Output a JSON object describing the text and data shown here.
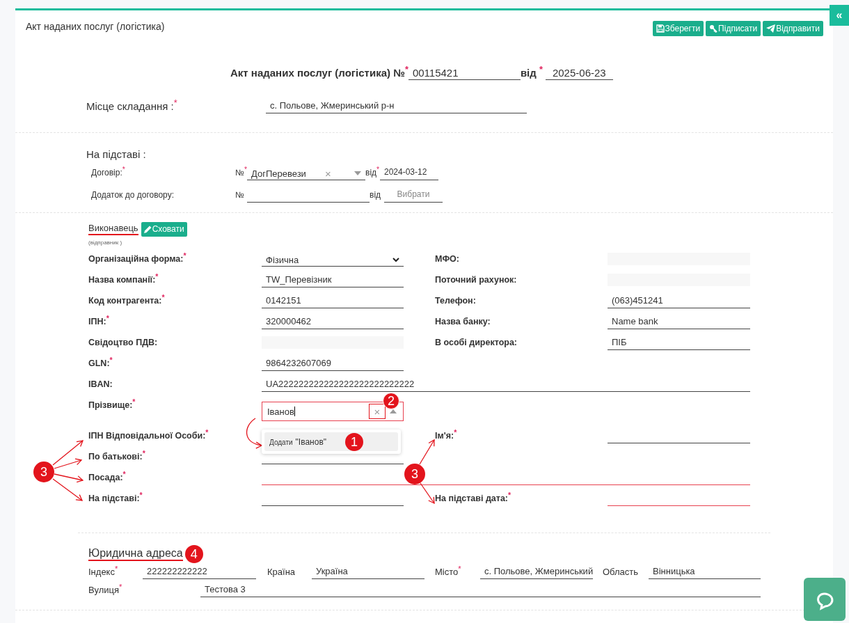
{
  "collapse_button": {
    "label": "«"
  },
  "header": {
    "title": "Акт наданих послуг (логістика)",
    "buttons": [
      {
        "label": "Зберегти",
        "kind": "save"
      },
      {
        "label": "Підписати",
        "kind": "sign"
      },
      {
        "label": "Відправити",
        "kind": "send"
      }
    ]
  },
  "document": {
    "label": "Акт наданих послуг (логістика) №$^{*}$",
    "number": "00115421",
    "date_label": "від $^{*}$",
    "date": "2025-06-23"
  },
  "place": {
    "label": "Місце складання :$^{*}$",
    "value": "с. Польове, Жмеринський р-н"
  },
  "basis": {
    "title": "На підставі :",
    "rows": [
      {
        "label": "Договір:$^{*}$",
        "number_label": "№$^{*}$",
        "number": "ДогПеревези",
        "clear": "×",
        "date_label": "від$^{*}$",
        "date": "2024-03-12"
      },
      {
        "label": "Додаток до договору:",
        "number_label": "№",
        "date_label": "від",
        "date_placeholder": "Вибрати"
      }
    ]
  },
  "executor": {
    "title": "Виконавець",
    "subtitle": "(відправник )",
    "toggle_button": "Сховати",
    "rows": [
      {
        "left": {
          "label": "Організаційна форма:$^{*}$",
          "kind": "select",
          "value": "Фізична"
        },
        "right": {
          "label": "МФО:",
          "kind": "readonly"
        }
      },
      {
        "left": {
          "label": "Назва компанії:$^{*}$",
          "kind": "input",
          "value": "TW_Перевізник"
        },
        "right": {
          "label": "Поточний рахунок:",
          "kind": "readonly"
        }
      },
      {
        "left": {
          "label": "Код контрагента:$^{*}$",
          "kind": "input",
          "value": "0142151"
        },
        "right": {
          "label": "Телефон:",
          "kind": "input",
          "value": "(063)451241"
        }
      },
      {
        "left": {
          "label": "ІПН:$^{*}$",
          "kind": "input",
          "value": "320000462"
        },
        "right": {
          "label": "Назва банку:",
          "kind": "input",
          "value": "Name bank"
        }
      },
      {
        "left": {
          "label": "Свідоцтво ПДВ:",
          "kind": "readonly"
        },
        "right": {
          "label": "В особі директора:",
          "kind": "input",
          "value": "ПІБ"
        }
      },
      {
        "left": {
          "label": "GLN:$^{*}$",
          "kind": "input",
          "value": "9864232607069"
        }
      },
      {
        "left": {
          "label": "IBAN:",
          "kind": "wide",
          "value": "UA222222222222222222222222222"
        }
      }
    ]
  },
  "person": {
    "surname": {
      "label": "Прізвище:$^{*}$",
      "value": "Іванов",
      "invalid": true,
      "clear": "×",
      "badge": "2",
      "option_prefix": "Додати",
      "option_value": "\"Іванов\"",
      "option_badge": "1"
    },
    "rows": [
      {
        "left": {
          "label": "ІПН Відповідальної Особи:$^{*}$",
          "kind": "none"
        },
        "right": {
          "label": "Ім'я:$^{*}$",
          "kind": "input",
          "invalid": false
        }
      },
      {
        "left": {
          "label": "По батькові:$^{*}$",
          "kind": "input",
          "invalid": false
        }
      },
      {
        "left": {
          "label": "Посада:$^{*}$",
          "kind": "wide",
          "invalid": true
        }
      },
      {
        "left": {
          "label": "На підставі:$^{*}$",
          "kind": "input",
          "invalid": false
        },
        "right": {
          "label": "На підставі дата:$^{*}$",
          "kind": "input",
          "invalid": true
        }
      }
    ],
    "callouts": [
      {
        "number": "3"
      },
      {
        "number": "3"
      }
    ]
  },
  "address": {
    "title": "Юридична адреса",
    "badge": "4",
    "rows": [
      {
        "fields": [
          {
            "label": "Індекс$^{*}$",
            "value": "222222222222"
          },
          {
            "label": "Країна",
            "value": "Україна"
          },
          {
            "label": "Місто$^{*}$",
            "value": "с. Польове, Жмеринський"
          },
          {
            "label": "Область",
            "value": "Вінницька"
          }
        ]
      },
      {
        "fields": [
          {
            "label": "Вулиця$^{*}$",
            "value": "Тестова 3"
          }
        ]
      }
    ]
  }
}
